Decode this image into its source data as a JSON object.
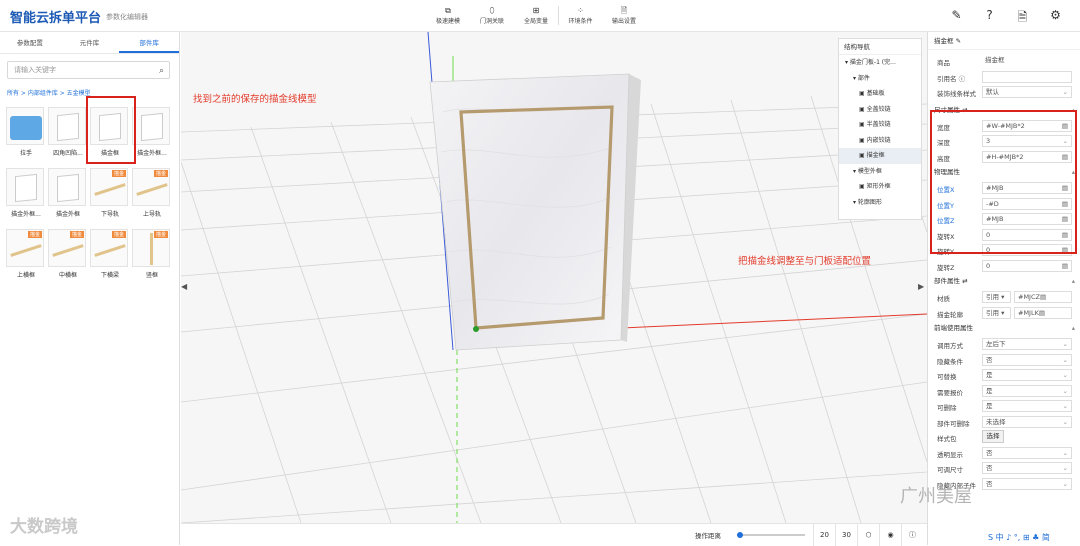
{
  "app": {
    "title": "智能云拆单平台",
    "subtitle": "参数化编辑器"
  },
  "toolbar": [
    {
      "icon": "⧉",
      "label": "极速建模"
    },
    {
      "icon": "⬯",
      "label": "门洞关联"
    },
    {
      "icon": "⊞",
      "label": "全局变量"
    },
    {
      "icon": "⁘",
      "label": "环境条件"
    },
    {
      "icon": "🗎",
      "label": "输出设置"
    }
  ],
  "top_right_icons": [
    "✎",
    "?",
    "🗎",
    "⚙"
  ],
  "left": {
    "tabs": [
      "参数配置",
      "元件库",
      "部件库"
    ],
    "search_placeholder": "请输入关键字",
    "breadcrumb": "所有 > 内部组件库 > 五金模型",
    "items": [
      {
        "label": "拉手",
        "kind": "folder"
      },
      {
        "label": "四角凹陷...",
        "kind": "panel"
      },
      {
        "label": "描金框",
        "kind": "panel"
      },
      {
        "label": "描金外框...",
        "kind": "panel"
      },
      {
        "label": "描金外框...",
        "kind": "panel"
      },
      {
        "label": "描金外框",
        "kind": "panel"
      },
      {
        "label": "下导轨",
        "kind": "rail",
        "badge": "描金"
      },
      {
        "label": "上导轨",
        "kind": "rail",
        "badge": "描金"
      },
      {
        "label": "上横框",
        "kind": "rail",
        "badge": "描金"
      },
      {
        "label": "中横框",
        "kind": "rail",
        "badge": "描金"
      },
      {
        "label": "下横梁",
        "kind": "rail",
        "badge": "描金"
      },
      {
        "label": "竖框",
        "kind": "vrail",
        "badge": "描金"
      }
    ]
  },
  "viewport": {
    "annotation_left": "找到之前的保存的描金线模型",
    "annotation_right": "把描金线调整至与门板适配位置",
    "nav": {
      "title": "结构导航",
      "items": [
        {
          "label": "描金门板-1 (完...",
          "level": 1
        },
        {
          "label": "部件",
          "level": 2
        },
        {
          "label": "基础板",
          "level": 3
        },
        {
          "label": "全盖铰链",
          "level": 3
        },
        {
          "label": "半盖铰链",
          "level": 3
        },
        {
          "label": "内嵌铰链",
          "level": 3
        },
        {
          "label": "描金框",
          "level": 3
        },
        {
          "label": "模型外框",
          "level": 2
        },
        {
          "label": "矩形外框",
          "level": 3
        },
        {
          "label": "轮廓图形",
          "level": 2
        }
      ]
    },
    "bottom": {
      "dist_label": "操作距离",
      "slider": 0.05,
      "btn_20": "20",
      "btn_30": "30"
    }
  },
  "right": {
    "title": "描金框",
    "rows": [
      {
        "k": "商品",
        "v": "描金框",
        "type": "plain"
      },
      {
        "k": "引用名 ⓘ",
        "v": "",
        "type": "input"
      },
      {
        "k": "装饰线条样式",
        "v": "默认",
        "type": "select"
      }
    ],
    "size_title": "尺寸属性",
    "size_rows": [
      {
        "k": "宽度",
        "v": "#W-#MJB*2"
      },
      {
        "k": "深度",
        "v": "3",
        "select": true
      },
      {
        "k": "高度",
        "v": "#H-#MJB*2"
      }
    ],
    "phys_title": "物理属性",
    "phys_rows": [
      {
        "k": "位置X",
        "v": "#MJB",
        "blue": true
      },
      {
        "k": "位置Y",
        "v": "-#D",
        "blue": true
      },
      {
        "k": "位置Z",
        "v": "#MJB",
        "blue": true
      },
      {
        "k": "旋转X",
        "v": "0"
      },
      {
        "k": "旋转Y",
        "v": "0"
      },
      {
        "k": "旋转Z",
        "v": "0"
      }
    ],
    "part_title": "部件属性",
    "part_rows": [
      {
        "k": "材质",
        "a": "引用 ▾",
        "b": "#MJCZ"
      },
      {
        "k": "描金轮廓",
        "a": "引用 ▾",
        "b": "#MJLK"
      }
    ],
    "use_title": "前端使用属性",
    "use_rows": [
      {
        "k": "调用方式",
        "v": "左后下"
      },
      {
        "k": "隐藏条件",
        "v": "否"
      },
      {
        "k": "可替换",
        "v": "是"
      },
      {
        "k": "需要报价",
        "v": "是"
      },
      {
        "k": "可删除",
        "v": "是"
      },
      {
        "k": "部件可删除",
        "v": "未选择"
      }
    ],
    "style_label": "样式包",
    "style_btn": "选择",
    "tail_rows": [
      {
        "k": "透明显示",
        "v": "否"
      },
      {
        "k": "可调尺寸",
        "v": "否"
      },
      {
        "k": "隐藏内部子件",
        "v": "否"
      }
    ]
  },
  "watermarks": {
    "left": "大数跨境",
    "right": "广州美屋"
  },
  "footer_icons": "S 中 ♪ °, ⊞ ♣ 简"
}
